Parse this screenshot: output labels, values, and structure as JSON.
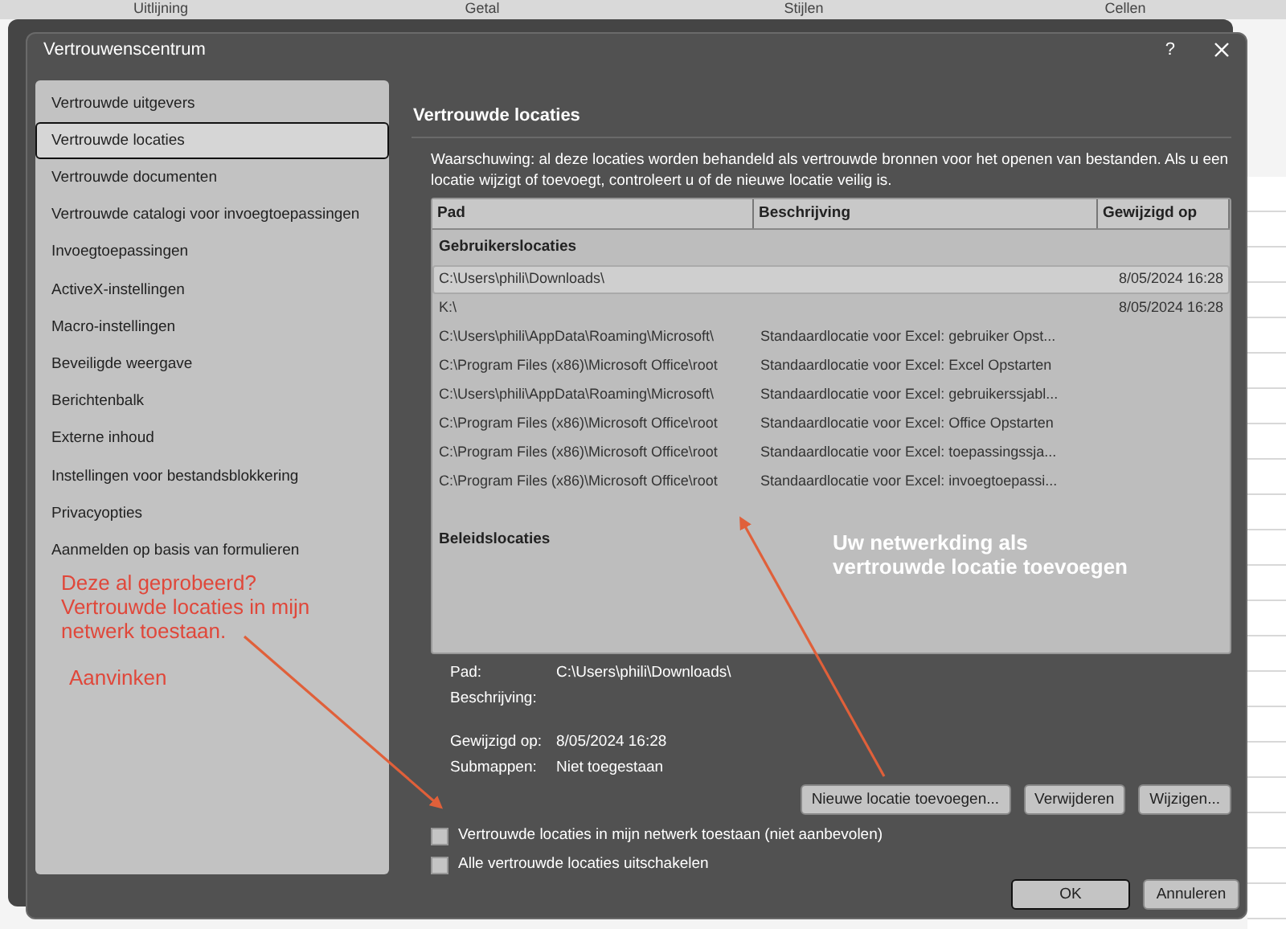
{
  "background_app": {
    "ribbon_groups": [
      "Uitlijning",
      "Getal",
      "Stijlen",
      "Cellen"
    ]
  },
  "dialog": {
    "title": "Vertrouwenscentrum",
    "help": "?"
  },
  "sidebar": {
    "items": [
      {
        "label": "Vertrouwde uitgevers",
        "selected": false
      },
      {
        "label": "Vertrouwde locaties",
        "selected": true
      },
      {
        "label": "Vertrouwde documenten",
        "selected": false
      },
      {
        "label": "Vertrouwde catalogi voor invoegtoepassingen",
        "selected": false
      },
      {
        "label": "Invoegtoepassingen",
        "selected": false
      },
      {
        "label": "ActiveX-instellingen",
        "selected": false
      },
      {
        "label": "Macro-instellingen",
        "selected": false
      },
      {
        "label": "Beveiligde weergave",
        "selected": false
      },
      {
        "label": "Berichtenbalk",
        "selected": false
      },
      {
        "label": "Externe inhoud",
        "selected": false
      },
      {
        "label": "Instellingen voor bestandsblokkering",
        "selected": false
      },
      {
        "label": "Privacyopties",
        "selected": false
      },
      {
        "label": "Aanmelden op basis van formulieren",
        "selected": false
      }
    ]
  },
  "section_title": "Vertrouwde locaties",
  "warning": "Waarschuwing: al deze locaties worden behandeld als vertrouwde bronnen voor het openen van bestanden. Als u een locatie wijzigt of toevoegt, controleert u of de nieuwe locatie veilig is.",
  "table": {
    "columns": [
      "Pad",
      "Beschrijving",
      "Gewijzigd op"
    ],
    "groups": [
      {
        "label": "Gebruikerslocaties",
        "rows": [
          {
            "cells": [
              "C:\\Users\\phili\\Downloads\\",
              "",
              "8/05/2024 16:28"
            ],
            "selected": true
          },
          {
            "cells": [
              "K:\\",
              "",
              "8/05/2024 16:28"
            ],
            "selected": false
          },
          {
            "cells": [
              "C:\\Users\\phili\\AppData\\Roaming\\Microsoft\\",
              "Standaardlocatie voor Excel: gebruiker Opst...",
              ""
            ],
            "selected": false
          },
          {
            "cells": [
              "C:\\Program Files (x86)\\Microsoft Office\\root",
              "Standaardlocatie voor Excel: Excel Opstarten",
              ""
            ],
            "selected": false
          },
          {
            "cells": [
              "C:\\Users\\phili\\AppData\\Roaming\\Microsoft\\",
              "Standaardlocatie voor Excel: gebruikerssjabl...",
              ""
            ],
            "selected": false
          },
          {
            "cells": [
              "C:\\Program Files (x86)\\Microsoft Office\\root",
              "Standaardlocatie voor Excel: Office Opstarten",
              ""
            ],
            "selected": false
          },
          {
            "cells": [
              "C:\\Program Files (x86)\\Microsoft Office\\root",
              "Standaardlocatie voor Excel: toepassingssja...",
              ""
            ],
            "selected": false
          },
          {
            "cells": [
              "C:\\Program Files (x86)\\Microsoft Office\\root",
              "Standaardlocatie voor Excel: invoegtoepassi...",
              ""
            ],
            "selected": false
          }
        ]
      },
      {
        "label": "Beleidslocaties"
      }
    ]
  },
  "details": [
    {
      "label": "Pad:",
      "value": "C:\\Users\\phili\\Downloads\\"
    },
    {
      "label": "Beschrijving:"
    },
    {
      "label": "Gewijzigd op:",
      "value": "8/05/2024 16:28"
    },
    {
      "label": "Submappen:",
      "value": "Niet toegestaan"
    }
  ],
  "actions": [
    "Nieuwe locatie toevoegen...",
    "Verwijderen",
    "Wijzigen..."
  ],
  "options": [
    {
      "label": "Vertrouwde locaties in mijn netwerk toestaan (niet aanbevolen)",
      "checked": false
    },
    {
      "label": "Alle vertrouwde locaties uitschakelen",
      "checked": false
    }
  ],
  "footer_buttons": [
    {
      "label": "OK",
      "default": true
    },
    {
      "label": "Annuleren",
      "default": false
    }
  ],
  "annotations": [
    {
      "text": "Deze al geprobeerd?\nVertrouwde locaties in mijn\nnetwerk toestaan.",
      "color": "#e0473a"
    },
    {
      "text": "Aanvinken",
      "color": "#e0473a"
    },
    {
      "text": "Uw netwerkding als\nvertrouwde locatie toevoegen",
      "color": "#ffffff"
    }
  ]
}
